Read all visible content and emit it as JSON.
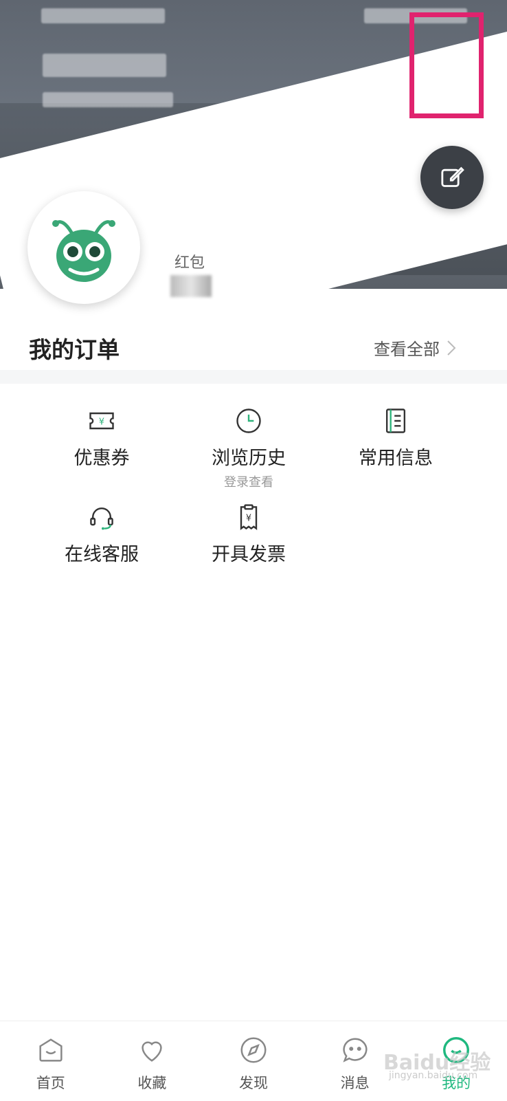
{
  "header": {
    "settings_icon": "gear-icon",
    "edit_icon": "edit-icon"
  },
  "profile": {
    "hongbao_label": "红包"
  },
  "orders": {
    "title": "我的订单",
    "view_all": "查看全部"
  },
  "services": [
    {
      "label": "优惠券",
      "sub": "",
      "icon": "coupon-icon"
    },
    {
      "label": "浏览历史",
      "sub": "登录查看",
      "icon": "clock-icon"
    },
    {
      "label": "常用信息",
      "sub": "",
      "icon": "notebook-icon"
    },
    {
      "label": "在线客服",
      "sub": "",
      "icon": "headset-icon"
    },
    {
      "label": "开具发票",
      "sub": "",
      "icon": "invoice-icon"
    }
  ],
  "tabbar": {
    "items": [
      {
        "label": "首页",
        "icon": "home-icon"
      },
      {
        "label": "收藏",
        "icon": "heart-icon"
      },
      {
        "label": "发现",
        "icon": "compass-icon"
      },
      {
        "label": "消息",
        "icon": "chat-icon"
      },
      {
        "label": "我的",
        "icon": "profile-icon"
      }
    ],
    "active": "我的"
  },
  "watermark": {
    "text": "Baidu经验",
    "sub": "jingyan.baidu.com"
  },
  "colors": {
    "accent": "#1fb87f",
    "highlight": "#e0236e"
  }
}
